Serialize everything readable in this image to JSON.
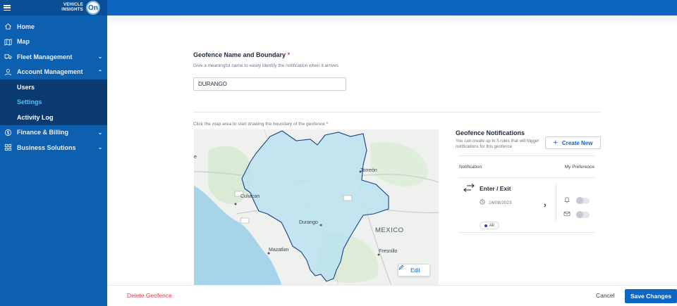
{
  "brand": {
    "logo_text_line1": "VEHICLE",
    "logo_text_line2": "INSIGHTS",
    "logo_badge": "On"
  },
  "sidebar": {
    "items": [
      {
        "label": "Home",
        "icon": "home-icon"
      },
      {
        "label": "Map",
        "icon": "map-icon"
      },
      {
        "label": "Fleet Management",
        "icon": "truck-icon"
      },
      {
        "label": "Account Management",
        "icon": "user-icon"
      },
      {
        "label": "Finance & Billing",
        "icon": "dollar-icon"
      },
      {
        "label": "Business Solutions",
        "icon": "grid-icon"
      }
    ],
    "sub_items": [
      {
        "label": "Users"
      },
      {
        "label": "Settings",
        "active": true
      },
      {
        "label": "Activity Log"
      }
    ]
  },
  "form": {
    "title": "Geofence Name and Boundary",
    "required_mark": "*",
    "subtitle": "Give a meaningful name to easily identify the notification when it arrives",
    "name_value": "DURANGO",
    "map_hint": "Click the map area to start drawing the boundary of the geofence"
  },
  "map": {
    "labels": {
      "culiacan": "Culiacan",
      "torreon": "Torreón",
      "durango": "Durango",
      "mexico": "MEXICO",
      "mazatlan": "Mazatlan",
      "fresnillo": "Fresnillo",
      "edge": "e"
    },
    "edit_label": "Edit",
    "colors": {
      "fill": "#bde3ee",
      "stroke": "#1c3f8a"
    }
  },
  "notifications": {
    "title": "Geofence Notifications",
    "subtitle": "You can create up to 5 rules that will trigger notifications for this geofence",
    "create_label": "Create New",
    "col_notification": "Notification",
    "col_preference": "My Preference",
    "card": {
      "type": "Enter / Exit",
      "date": "16/08/2023",
      "chip": "All"
    }
  },
  "footer": {
    "delete_label": "Delete Geofence",
    "cancel_label": "Cancel",
    "save_label": "Save Changes"
  }
}
